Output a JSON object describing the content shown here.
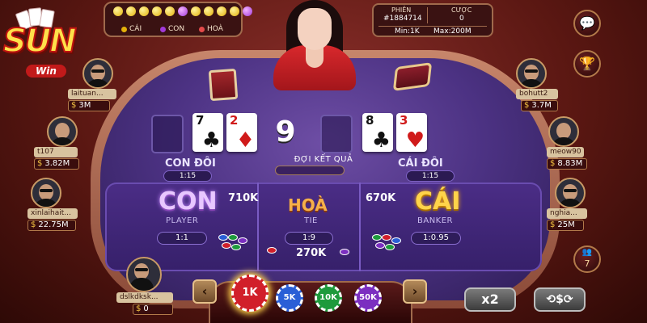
{
  "logo": {
    "text": "SUN",
    "sub": "Win"
  },
  "road": {
    "dots": [
      "yellow",
      "yellow",
      "yellow",
      "yellow",
      "yellow",
      "purple",
      "yellow",
      "yellow",
      "yellow",
      "yellow",
      "purple"
    ],
    "legend": [
      {
        "label": "CÁI",
        "color": "#e3b10a"
      },
      {
        "label": "CON",
        "color": "#a23ad8"
      },
      {
        "label": "HOÀ",
        "color": "#e34a4a"
      }
    ]
  },
  "session": {
    "phien_label": "PHIÊN",
    "phien_value": "#1884714",
    "cuoc_label": "CƯỢC",
    "cuoc_value": "0",
    "min_label": "Min:",
    "min_value": "1K",
    "max_label": "Max:",
    "max_value": "200M"
  },
  "side_buttons": {
    "chat_icon": "chat-icon",
    "trophy_icon": "trophy-icon",
    "online_count": "7"
  },
  "players_left": [
    {
      "name": "laituan...",
      "balance": "3M"
    },
    {
      "name": "t107",
      "balance": "3.82M"
    },
    {
      "name": "xinlaihait...",
      "balance": "22.75M"
    }
  ],
  "players_right": [
    {
      "name": "bohutt2",
      "balance": "3.7M"
    },
    {
      "name": "meow90",
      "balance": "8.83M"
    },
    {
      "name": "nghia...",
      "balance": "25M"
    }
  ],
  "self_player": {
    "name": "dslkdksk...",
    "balance": "0"
  },
  "table": {
    "player_cards": [
      {
        "rank": "7",
        "suit": "♣",
        "color": "black"
      },
      {
        "rank": "2",
        "suit": "♦",
        "color": "red"
      }
    ],
    "banker_cards": [
      {
        "rank": "8",
        "suit": "♣",
        "color": "black"
      },
      {
        "rank": "3",
        "suit": "♥",
        "color": "red"
      }
    ],
    "center_score": "9",
    "status": "ĐỢI KẾT QUẢ",
    "con_doi": {
      "label": "CON ĐÔI",
      "ratio": "1:15"
    },
    "cai_doi": {
      "label": "CÁI ĐÔI",
      "ratio": "1:15"
    },
    "con": {
      "label": "CON",
      "sub": "PLAYER",
      "ratio": "1:1",
      "amount": "710K"
    },
    "hoa": {
      "label": "HOÀ",
      "sub": "TIE",
      "ratio": "1:9",
      "amount": "270K"
    },
    "cai": {
      "label": "CÁI",
      "sub": "BANKER",
      "ratio": "1:0.95",
      "amount": "670K"
    }
  },
  "chips": [
    {
      "label": "1K",
      "color": "#d11f2a",
      "selected": true
    },
    {
      "label": "5K",
      "color": "#2a5fd6",
      "selected": false
    },
    {
      "label": "10K",
      "color": "#1e9a3c",
      "selected": false
    },
    {
      "label": "50K",
      "color": "#7b2fc0",
      "selected": false
    }
  ],
  "controls": {
    "prev": "‹",
    "next": "›",
    "x2": "x2",
    "rebet": "⟲$⟳"
  }
}
